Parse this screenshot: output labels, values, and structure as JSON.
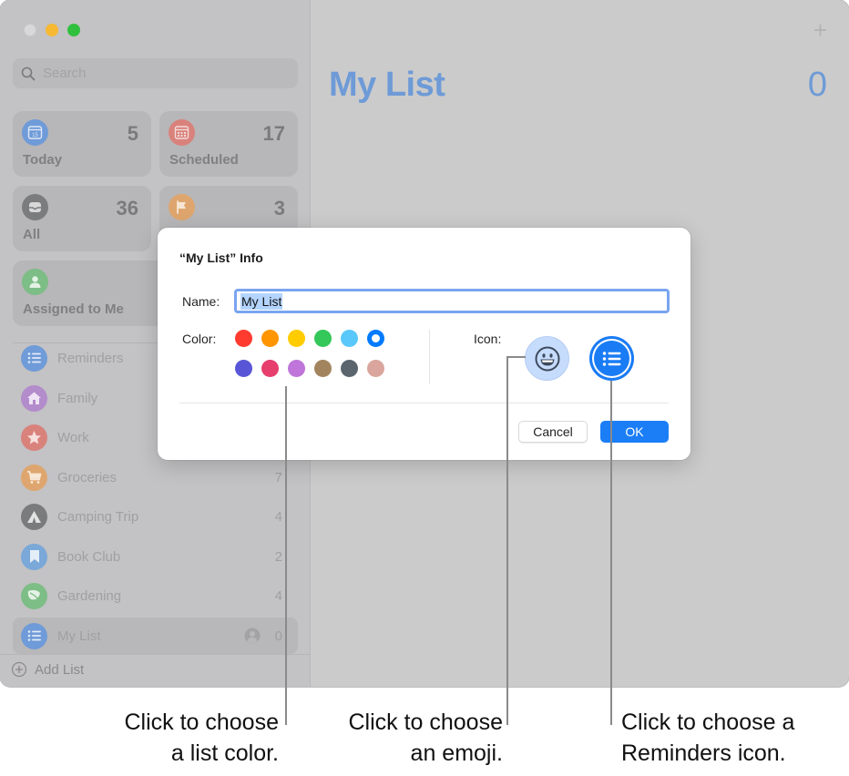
{
  "window": {
    "traffic_lights": [
      "close",
      "minimize",
      "maximize"
    ]
  },
  "sidebar": {
    "search": {
      "placeholder": "Search",
      "icon": "search-icon"
    },
    "smart_lists": [
      {
        "label": "Today",
        "count": "5",
        "icon": "calendar-today-icon",
        "color": "#6f9bd8"
      },
      {
        "label": "Scheduled",
        "count": "17",
        "icon": "calendar-icon",
        "color": "#d9827c"
      },
      {
        "label": "All",
        "count": "36",
        "icon": "tray-icon",
        "color": "#7b7c7d"
      },
      {
        "label": "",
        "count": "3",
        "icon": "flag-icon",
        "color": "#dea66e"
      },
      {
        "label": "Assigned to Me",
        "count": "",
        "icon": "person-icon",
        "color": "#7dbd86"
      }
    ],
    "lists": [
      {
        "name": "Reminders",
        "count": "",
        "icon": "list-bullet-icon",
        "color": "#6f9bd8"
      },
      {
        "name": "Family",
        "count": "",
        "icon": "house-icon",
        "color": "#b38ccb"
      },
      {
        "name": "Work",
        "count": "",
        "icon": "star-icon",
        "color": "#d9827c"
      },
      {
        "name": "Groceries",
        "count": "7",
        "icon": "cart-icon",
        "color": "#dea66e"
      },
      {
        "name": "Camping Trip",
        "count": "4",
        "icon": "tent-icon",
        "color": "#7a7b7c"
      },
      {
        "name": "Book Club",
        "count": "2",
        "icon": "bookmark-icon",
        "color": "#7aa8d8"
      },
      {
        "name": "Gardening",
        "count": "4",
        "icon": "leaf-icon",
        "color": "#7dbd86"
      },
      {
        "name": "My List",
        "count": "0",
        "icon": "list-bullet-icon",
        "color": "#6f9bd8",
        "selected": true,
        "shared": true
      }
    ],
    "add_list_label": "Add List"
  },
  "main": {
    "title": "My List",
    "count": "0",
    "add_icon": "plus-icon"
  },
  "dialog": {
    "title": "“My List” Info",
    "name_label": "Name:",
    "name_value": "My List",
    "color_label": "Color:",
    "colors": [
      {
        "name": "red",
        "hex": "#ff3b30"
      },
      {
        "name": "orange",
        "hex": "#ff9500"
      },
      {
        "name": "yellow",
        "hex": "#ffcc00"
      },
      {
        "name": "green",
        "hex": "#34c759"
      },
      {
        "name": "light-blue",
        "hex": "#5ac8fa"
      },
      {
        "name": "blue",
        "hex": "#007aff",
        "selected": true
      },
      {
        "name": "indigo",
        "hex": "#5856d6"
      },
      {
        "name": "pink",
        "hex": "#e63e6d"
      },
      {
        "name": "purple",
        "hex": "#bf75d9"
      },
      {
        "name": "brown",
        "hex": "#a2845e"
      },
      {
        "name": "gray",
        "hex": "#5b656e"
      },
      {
        "name": "rose-gold",
        "hex": "#d9a59c"
      }
    ],
    "icon_label": "Icon:",
    "icon_options": [
      {
        "name": "emoji",
        "icon": "smiley-icon"
      },
      {
        "name": "reminders-icon",
        "icon": "list-bullet-icon",
        "selected": true
      }
    ],
    "cancel_label": "Cancel",
    "ok_label": "OK"
  },
  "callouts": [
    {
      "line1": "Click to choose",
      "line2": "a list color."
    },
    {
      "line1": "Click to choose",
      "line2": "an emoji."
    },
    {
      "line1": "Click to choose a",
      "line2": "Reminders icon."
    }
  ]
}
